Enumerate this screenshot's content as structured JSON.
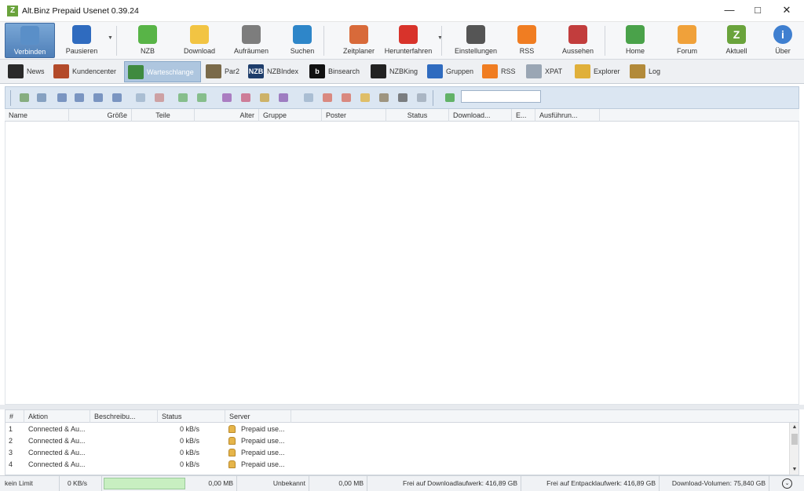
{
  "window": {
    "title": "Alt.Binz Prepaid Usenet 0.39.24",
    "app_icon": "Z"
  },
  "toolbar": [
    {
      "id": "verbinden",
      "label": "Verbinden",
      "icon": "connect-icon",
      "color": "#5a8fc8",
      "active": true
    },
    {
      "id": "pausieren",
      "label": "Pausieren",
      "icon": "pause-icon",
      "color": "#2f6bbf",
      "arrow": true
    },
    {
      "id": "nzb",
      "label": "NZB",
      "icon": "nzb-add-icon",
      "color": "#58b447"
    },
    {
      "id": "download",
      "label": "Download",
      "icon": "folder-icon",
      "color": "#f2c443"
    },
    {
      "id": "aufraeumen",
      "label": "Aufräumen",
      "icon": "trash-icon",
      "color": "#7d7d7d"
    },
    {
      "id": "suchen",
      "label": "Suchen",
      "icon": "search-icon",
      "color": "#2e86c9"
    },
    {
      "id": "zeitplaner",
      "label": "Zeitplaner",
      "icon": "scheduler-icon",
      "color": "#d86a3a"
    },
    {
      "id": "herunterfahren",
      "label": "Herunterfahren",
      "icon": "power-icon",
      "color": "#d8332b",
      "arrow": true
    },
    {
      "id": "einstellungen",
      "label": "Einstellungen",
      "icon": "gear-icon",
      "color": "#555555"
    },
    {
      "id": "rss",
      "label": "RSS",
      "icon": "rss-icon",
      "color": "#f07d22"
    },
    {
      "id": "aussehen",
      "label": "Aussehen",
      "icon": "cubes-icon",
      "color": "#c23d3d"
    },
    {
      "id": "home",
      "label": "Home",
      "icon": "home-icon",
      "color": "#4aa24a"
    },
    {
      "id": "forum",
      "label": "Forum",
      "icon": "people-icon",
      "color": "#f0a13a"
    },
    {
      "id": "aktuell",
      "label": "Aktuell",
      "icon": "update-icon",
      "color": "#6aa33c",
      "glyph": "Z"
    },
    {
      "id": "ueber",
      "label": "Über",
      "icon": "info-icon",
      "color": "#3f7fd0",
      "glyph": "i"
    }
  ],
  "tabs": [
    {
      "id": "news",
      "label": "News",
      "icon": "home-icon",
      "color": "#2a2a2a"
    },
    {
      "id": "kundencenter",
      "label": "Kundencenter",
      "icon": "customer-icon",
      "color": "#b34a2a"
    },
    {
      "id": "warteschlange",
      "label": "Warteschlange",
      "icon": "queue-icon",
      "color": "#3f8a3f",
      "active": true
    },
    {
      "id": "par2",
      "label": "Par2",
      "icon": "par2-icon",
      "color": "#7a6a4a"
    },
    {
      "id": "nzbindex",
      "label": "NZBIndex",
      "icon": "nzbindex-icon",
      "color": "#1e3d6b",
      "glyph": "NZB"
    },
    {
      "id": "binsearch",
      "label": "Binsearch",
      "icon": "binsearch-icon",
      "color": "#111111",
      "glyph": "b"
    },
    {
      "id": "nzbking",
      "label": "NZBKing",
      "icon": "crown-icon",
      "color": "#222222"
    },
    {
      "id": "gruppen",
      "label": "Gruppen",
      "icon": "groups-icon",
      "color": "#2f6bbf"
    },
    {
      "id": "rss",
      "label": "RSS",
      "icon": "rss-icon",
      "color": "#f07d22"
    },
    {
      "id": "xpat",
      "label": "XPAT",
      "icon": "xpat-icon",
      "color": "#9aa6b4"
    },
    {
      "id": "explorer",
      "label": "Explorer",
      "icon": "explorer-icon",
      "color": "#e0b03a"
    },
    {
      "id": "log",
      "label": "Log",
      "icon": "log-icon",
      "color": "#b28a3a"
    }
  ],
  "queue": {
    "columns": [
      "Name",
      "Größe",
      "Teile",
      "Alter",
      "Gruppe",
      "Poster",
      "Status",
      "Download...",
      "E...",
      "Ausführun..."
    ],
    "search_value": ""
  },
  "connections": {
    "columns": [
      "#",
      "Aktion",
      "Beschreibu...",
      "Status",
      "Server"
    ],
    "rows": [
      {
        "num": "1",
        "action": "Connected & Au...",
        "status": "0 kB/s",
        "server": "Prepaid use..."
      },
      {
        "num": "2",
        "action": "Connected & Au...",
        "status": "0 kB/s",
        "server": "Prepaid use..."
      },
      {
        "num": "3",
        "action": "Connected & Au...",
        "status": "0 kB/s",
        "server": "Prepaid use..."
      },
      {
        "num": "4",
        "action": "Connected & Au...",
        "status": "0 kB/s",
        "server": "Prepaid use..."
      }
    ]
  },
  "statusbar": {
    "limit": "kein Limit",
    "speed": "0 KB/s",
    "size1": "0,00 MB",
    "eta": "Unbekannt",
    "size2": "0,00 MB",
    "free_download": "Frei auf Downloadlaufwerk: 416,89 GB",
    "free_extract": "Frei auf Entpacklaufwerk: 416,89 GB",
    "volume": "Download-Volumen: 75,840 GB"
  }
}
